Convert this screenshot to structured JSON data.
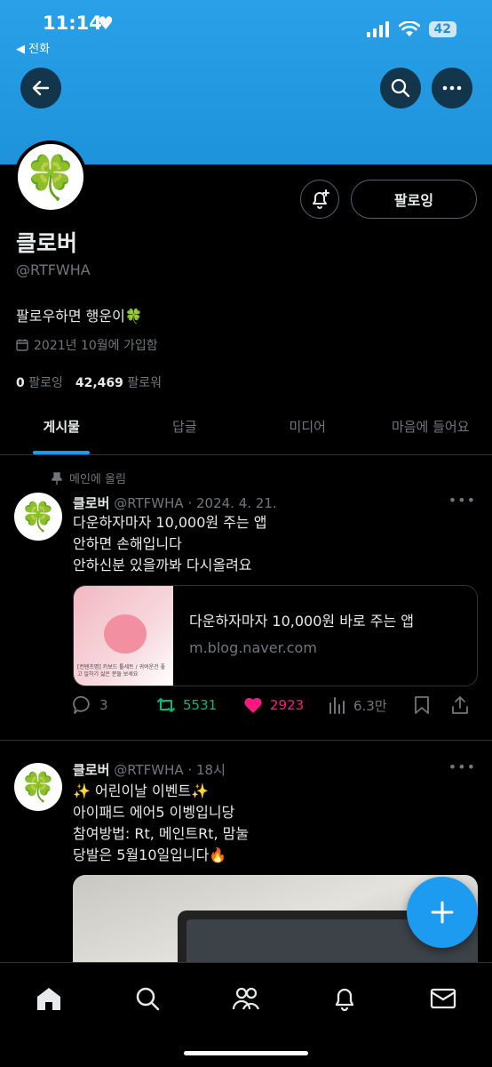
{
  "status_bar": {
    "time": "11:14",
    "back_label": "◀ 전화",
    "battery": "42"
  },
  "profile": {
    "name": "클로버",
    "handle": "@RTFWHA",
    "bio": "팔로우하면 행운이🍀",
    "joined": "2021년 10월에 가입함",
    "following_count": "0",
    "following_label": "팔로잉",
    "followers_count": "42,469",
    "followers_label": "팔로워",
    "follow_button": "팔로잉"
  },
  "tabs": [
    "게시물",
    "답글",
    "미디어",
    "마음에 들어요"
  ],
  "pinned_label": "메인에 올림",
  "posts": [
    {
      "name": "클로버",
      "meta": "@RTFWHA · 2024. 4. 21.",
      "lines": [
        "다운하자마자 10,000원 주는 앱",
        "안하면 손해입니다",
        "안하신분 있을까봐 다시올려요"
      ],
      "card": {
        "title": "다운하자마자 10,000원 바로 주는 앱",
        "domain": "m.blog.naver.com",
        "thumb_text": "[컨텐츠명] 키보드 툴세트 / 귀여운건 좋고 일하기 싫은 분들 보세요"
      },
      "replies": "3",
      "reposts": "5531",
      "likes": "2923",
      "views": "6.3만"
    },
    {
      "name": "클로버",
      "meta": "@RTFWHA · 18시",
      "lines": [
        "✨ 어린이날 이벤트✨",
        "아이패드 에어5 이벵입니당",
        "참여방법: Rt, 메인트Rt, 맘눌",
        "당발은 5월10일입니다🔥"
      ]
    }
  ],
  "colors": {
    "accent": "#1d9bf0",
    "banner": "#1d93dc",
    "repost": "#00ba7c",
    "like": "#f91880"
  }
}
